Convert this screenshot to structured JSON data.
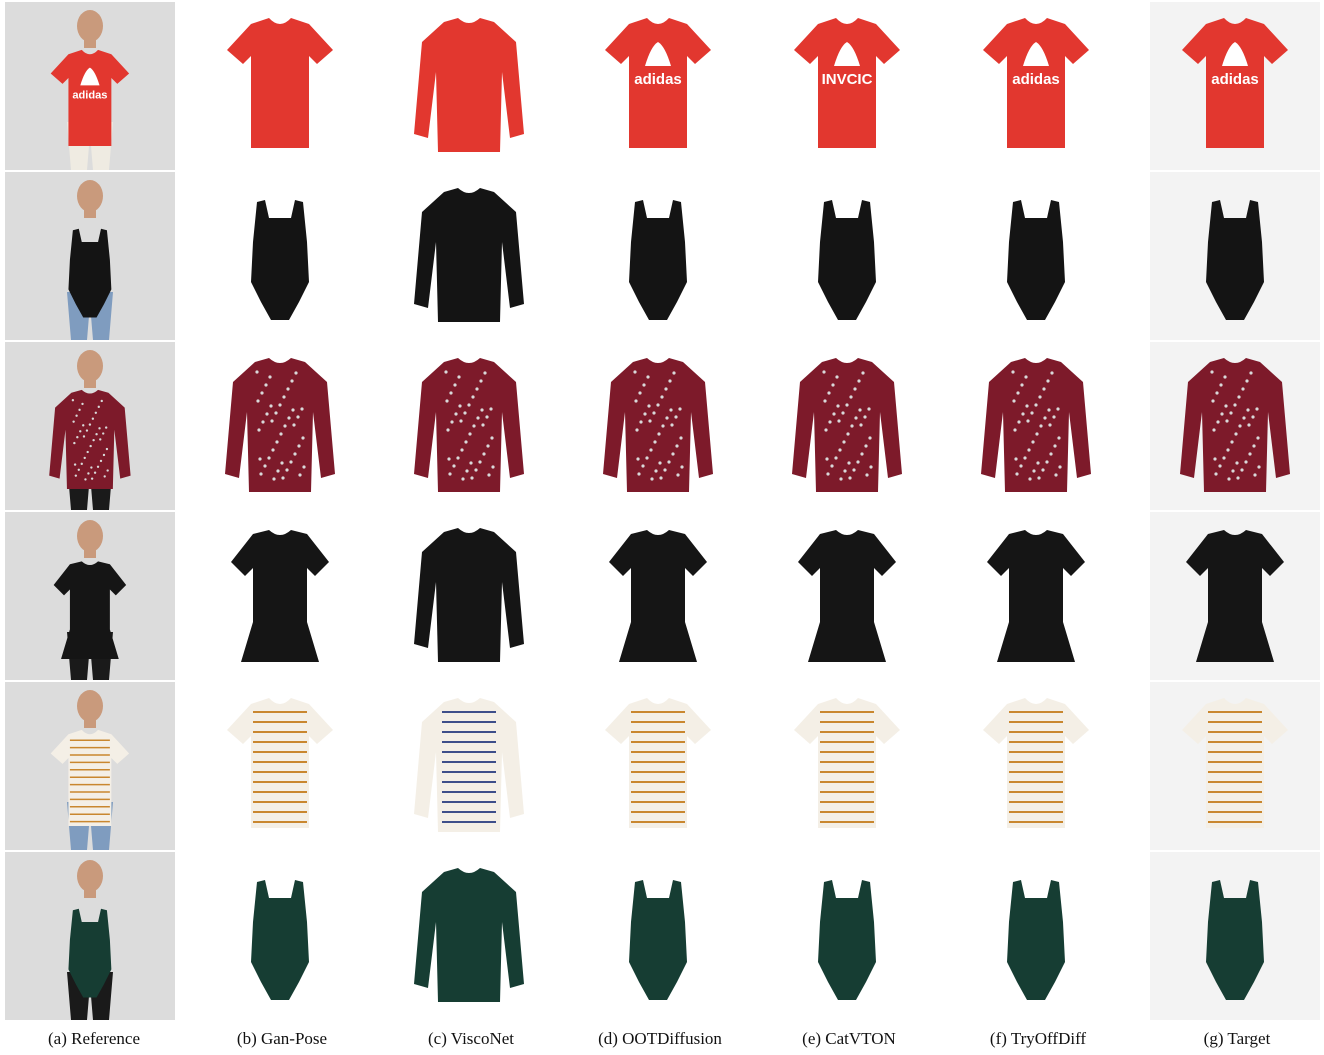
{
  "figure": {
    "columns": [
      {
        "key": "reference",
        "caption": "(a) Reference"
      },
      {
        "key": "ganpose",
        "caption": "(b) Gan-Pose"
      },
      {
        "key": "visconet",
        "caption": "(c) ViscoNet"
      },
      {
        "key": "ootd",
        "caption": "(d) OOTDiffusion"
      },
      {
        "key": "catvton",
        "caption": "(e) CatVTON"
      },
      {
        "key": "tryoffdiff",
        "caption": "(f) TryOffDiff"
      },
      {
        "key": "target",
        "caption": "(g) Target"
      }
    ],
    "rows": [
      {
        "garment": "red-tshirt-with-trefoil-logo",
        "color": "#e2372f",
        "accent": "#ffffff",
        "cells": {
          "reference": {
            "print": "adidas"
          },
          "ganpose": {
            "print": ""
          },
          "visconet": {
            "print": ""
          },
          "ootd": {
            "print": "adidas"
          },
          "catvton": {
            "print": "INVCIC"
          },
          "tryoffdiff": {
            "print": "adidas"
          },
          "target": {
            "print": "adidas"
          }
        }
      },
      {
        "garment": "black-lace-bodysuit",
        "color": "#141414",
        "accent": "#3a3a3a",
        "cells": {}
      },
      {
        "garment": "red-floral-blouse",
        "color": "#7d1a2a",
        "accent": "#d9d9d9",
        "cells": {}
      },
      {
        "garment": "black-lace-peplum-top",
        "color": "#151515",
        "accent": "#444444",
        "cells": {}
      },
      {
        "garment": "white-striped-tie-front-tee",
        "color": "#f4efe6",
        "accent": "#c9872f",
        "cells": {}
      },
      {
        "garment": "dark-green-lace-up-bodysuit",
        "color": "#163d33",
        "accent": "#0d2a22",
        "cells": {}
      }
    ]
  }
}
